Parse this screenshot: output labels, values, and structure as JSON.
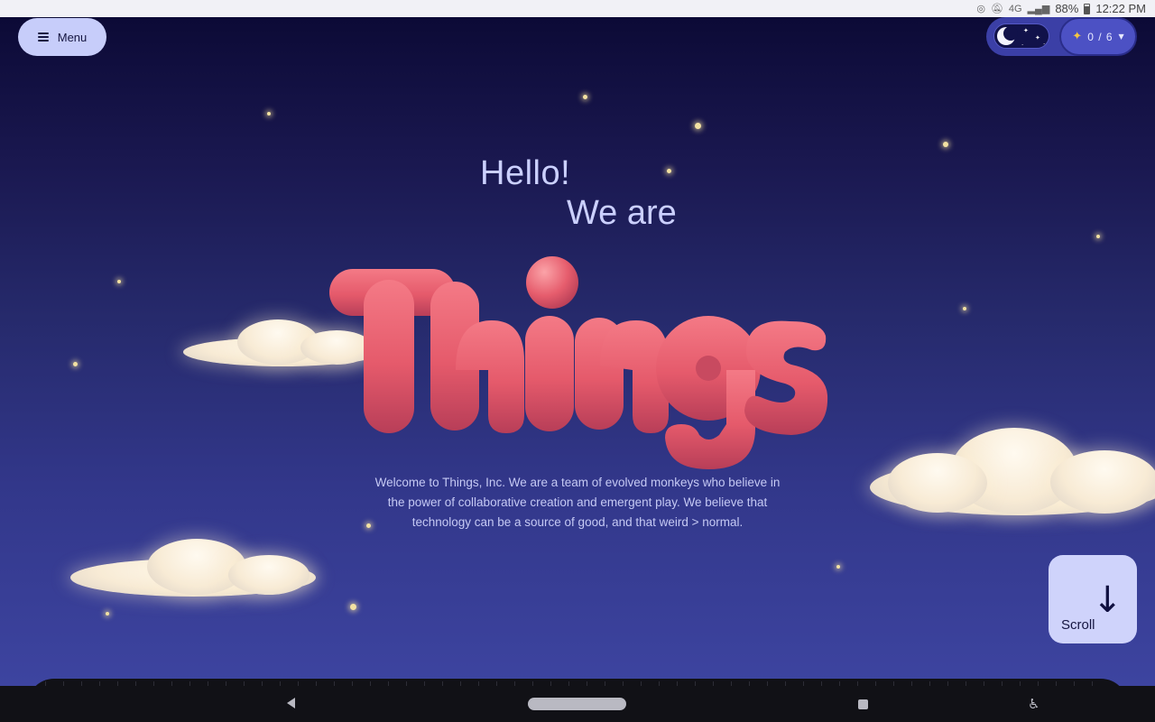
{
  "status_bar": {
    "network": "4G",
    "battery": "88%",
    "time": "12:22 PM"
  },
  "menu": {
    "label": "Menu",
    "icon": "hamburger-icon"
  },
  "theme_toggle": {
    "mode": "night",
    "icon": "moon-icon"
  },
  "collectibles": {
    "count": "0 / 6",
    "icon": "sparkle-icon"
  },
  "hero": {
    "line1": "Hello!",
    "line2": "We are",
    "brand": "Things",
    "brand_color": "#ea5b6f",
    "description": "Welcome to Things, Inc. We are a team of evolved monkeys who believe in the power of collaborative creation and emergent play. We believe that technology can be a source of good, and that weird > normal."
  },
  "scroll": {
    "label": "Scroll",
    "icon": "arrow-down-icon"
  },
  "nav": {
    "back_icon": "back-icon",
    "home_icon": "home-pill-icon",
    "recent_icon": "recents-icon",
    "accessibility_icon": "accessibility-icon"
  },
  "colors": {
    "sky_top": "#0c0a36",
    "sky_bottom": "#3d44a0",
    "button_bg": "#c7cdfa",
    "text_light": "#cbd0ff"
  }
}
